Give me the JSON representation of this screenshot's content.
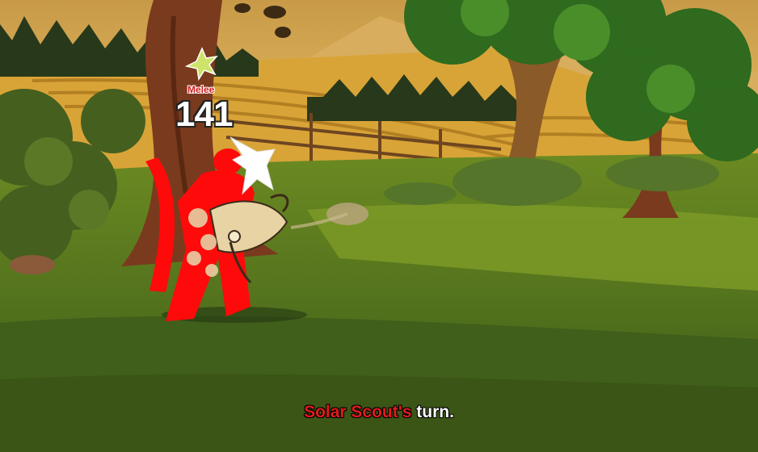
{
  "battle": {
    "hit_type": "Melee",
    "damage": "141",
    "turn_actor": "Solar Scout's",
    "turn_suffix": " turn."
  },
  "colors": {
    "sky": "#e8b758",
    "field_gold": "#d9a437",
    "grass_dark": "#4c6b1f",
    "grass_light": "#74921f",
    "attacker_red": "#ff0a0a",
    "actor_text": "#e11b1b"
  },
  "icons": [
    "hit-star-icon",
    "impact-slash-icon"
  ]
}
